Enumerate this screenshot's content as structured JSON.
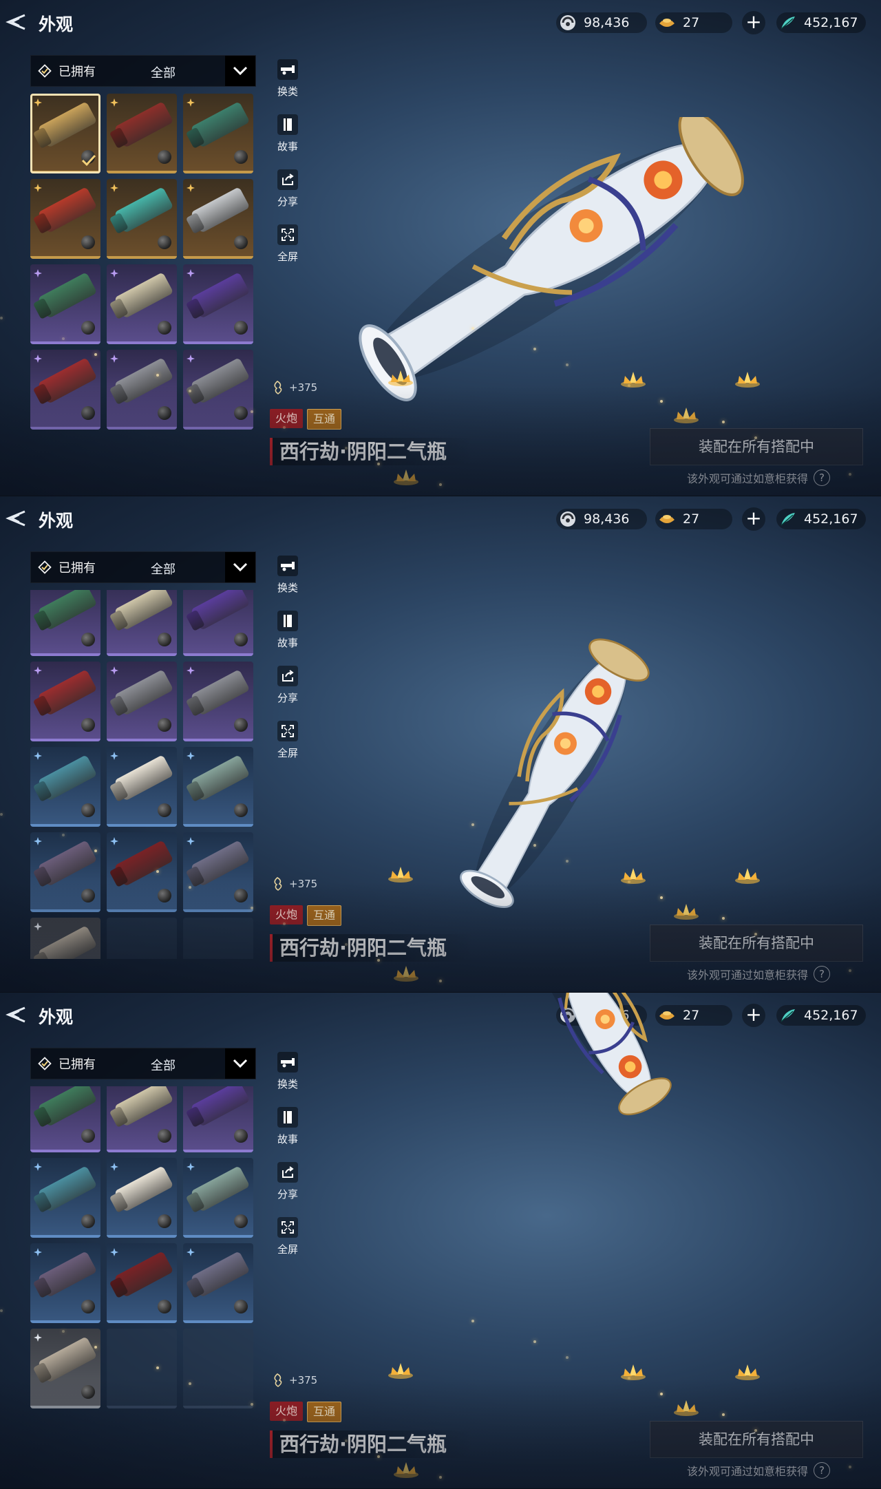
{
  "header": {
    "title": "外观"
  },
  "currencies": [
    {
      "icon": "silver-coin-icon",
      "value": "98,436"
    },
    {
      "icon": "gold-ingot-icon",
      "value": "27"
    },
    {
      "icon": "jade-feather-icon",
      "value": "452,167"
    }
  ],
  "filter": {
    "owned_label": "已拥有",
    "category_label": "全部"
  },
  "side_actions": {
    "switch": "换类",
    "story": "故事",
    "share": "分享",
    "fullscreen": "全屏"
  },
  "item": {
    "power": "+375",
    "tags": [
      "火炮",
      "互通"
    ],
    "name": "西行劫·阴阳二气瓶"
  },
  "equip_button": "装配在所有搭配中",
  "obtain_hint": "该外观可通过如意柜获得",
  "colors": {
    "accent_red": "#c8252b",
    "gold_rarity": "#c59a4a",
    "purple_rarity": "#8d7bd0",
    "blue_rarity": "#5f8cc3"
  },
  "grid_views": [
    {
      "rows": [
        [
          "gold-selected",
          "gold",
          "gold"
        ],
        [
          "gold",
          "gold",
          "gold"
        ],
        [
          "purple",
          "purple",
          "purple"
        ],
        [
          "purple",
          "purple",
          "purple"
        ]
      ]
    },
    {
      "rows": [
        [
          "purple",
          "purple",
          "purple"
        ],
        [
          "purple",
          "purple",
          "purple"
        ],
        [
          "blue",
          "blue",
          "blue"
        ],
        [
          "blue",
          "blue",
          "blue"
        ],
        [
          "gray",
          "empty",
          "empty"
        ]
      ]
    },
    {
      "rows": [
        [
          "purple",
          "purple",
          "purple"
        ],
        [
          "blue",
          "blue",
          "blue"
        ],
        [
          "blue",
          "blue",
          "blue"
        ],
        [
          "gray",
          "empty",
          "empty"
        ]
      ]
    }
  ]
}
